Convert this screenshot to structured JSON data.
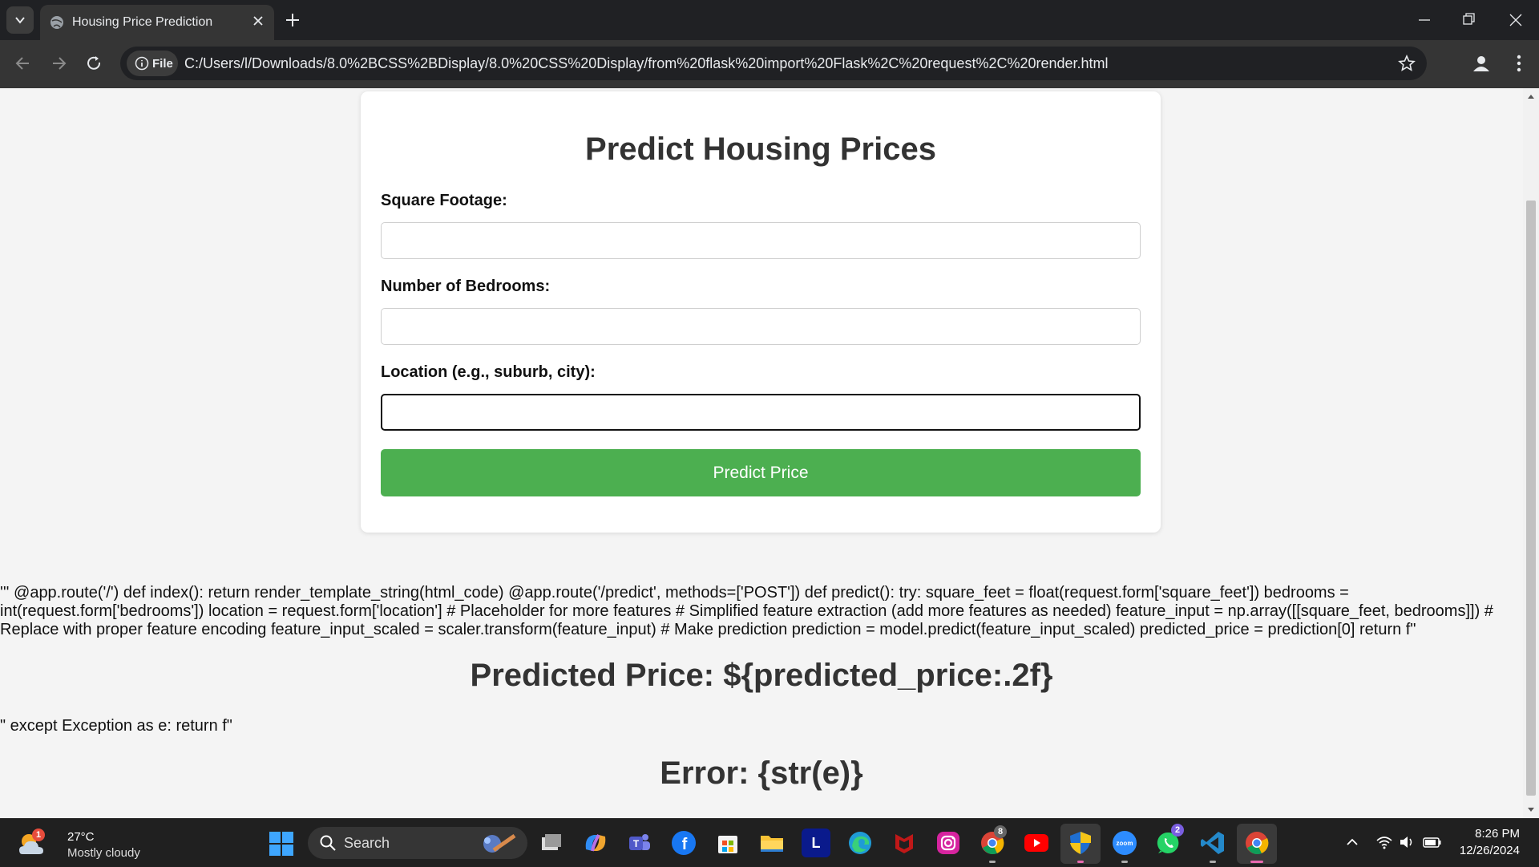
{
  "browser": {
    "tab_title": "Housing Price Prediction",
    "site_info_label": "File",
    "url": "C:/Users/l/Downloads/8.0%2BCSS%2BDisplay/8.0%20CSS%20Display/from%20flask%20import%20Flask%2C%20request%2C%20render.html"
  },
  "form": {
    "heading": "Predict Housing Prices",
    "square_footage_label": "Square Footage:",
    "bedrooms_label": "Number of Bedrooms:",
    "location_label": "Location (e.g., suburb, city):",
    "square_footage_value": "",
    "bedrooms_value": "",
    "location_value": "",
    "submit_label": "Predict Price"
  },
  "page_text": {
    "code_dump": "''' @app.route('/') def index(): return render_template_string(html_code) @app.route('/predict', methods=['POST']) def predict(): try: square_feet = float(request.form['square_feet']) bedrooms = int(request.form['bedrooms']) location = request.form['location'] # Placeholder for more features # Simplified feature extraction (add more features as needed) feature_input = np.array([[square_feet, bedrooms]]) # Replace with proper feature encoding feature_input_scaled = scaler.transform(feature_input) # Make prediction prediction = model.predict(feature_input_scaled) predicted_price = prediction[0] return f\"",
    "predicted_heading": "Predicted Price: ${predicted_price:.2f}",
    "except_line": "\" except Exception as e: return f\"",
    "error_heading": "Error: {str(e)}"
  },
  "taskbar": {
    "weather_badge": "1",
    "weather_temp": "27°C",
    "weather_desc": "Mostly cloudy",
    "search_label": "Search",
    "chrome_badge": "8",
    "whatsapp_badge": "2",
    "clock_time": "8:26 PM",
    "clock_date": "12/26/2024",
    "apps": [
      "widgets",
      "task-view",
      "copilot",
      "teams",
      "facebook",
      "microsoft-store",
      "file-explorer",
      "l-app",
      "edge",
      "mcafee",
      "instagram",
      "chrome",
      "youtube",
      "security",
      "zoom",
      "whatsapp",
      "vscode",
      "chrome-active"
    ]
  },
  "colors": {
    "predict_button": "#4caf50",
    "tab_strip": "#202124",
    "toolbar": "#353535"
  }
}
